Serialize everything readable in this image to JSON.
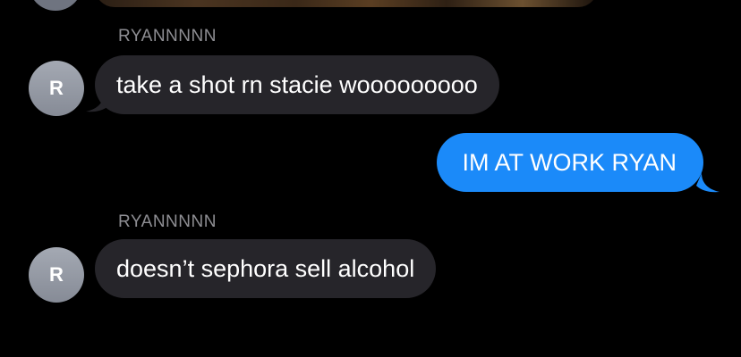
{
  "colors": {
    "background": "#000000",
    "incoming_bubble": "#26252a",
    "outgoing_bubble": "#1b8af9",
    "sender_name": "#8e8e93",
    "avatar": "#969ba5"
  },
  "messages": [
    {
      "direction": "incoming",
      "sender": "RYANNNNN",
      "avatar_initial": "R",
      "text": "take a shot rn stacie wooooooooo"
    },
    {
      "direction": "outgoing",
      "text": "IM AT WORK RYAN"
    },
    {
      "direction": "incoming",
      "sender": "RYANNNNN",
      "avatar_initial": "R",
      "text": "doesn’t sephora sell alcohol"
    }
  ],
  "image_message": {
    "icon": "photo-attachment"
  }
}
